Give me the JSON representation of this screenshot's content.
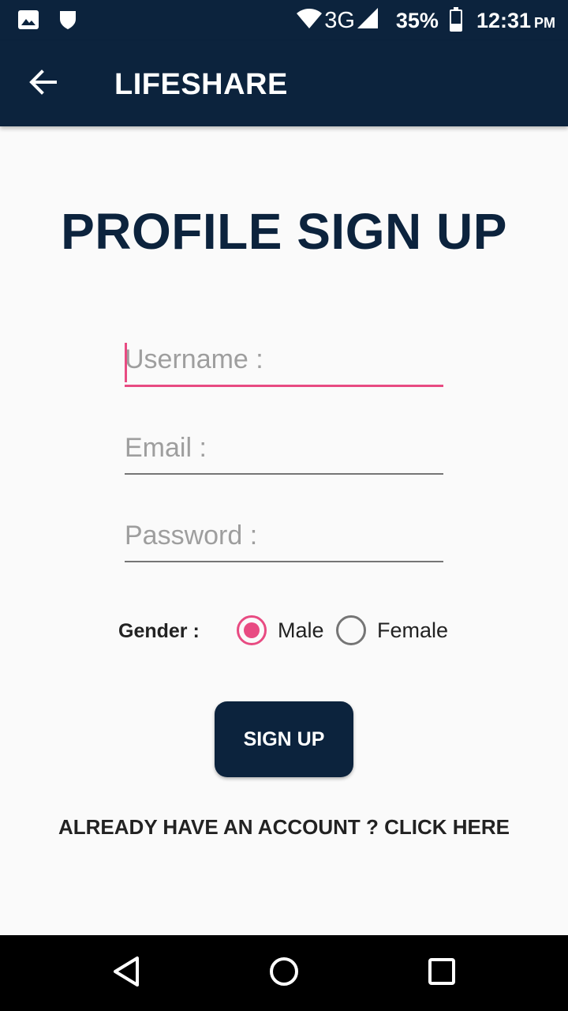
{
  "status_bar": {
    "network": "3G",
    "battery": "35%",
    "battery_level": 0.35,
    "time": "12:31",
    "ampm": "PM",
    "icons": [
      "image-icon",
      "shield-icon",
      "wifi-icon",
      "signal-icon",
      "battery-icon"
    ]
  },
  "app_bar": {
    "title": "LIFESHARE",
    "back_icon": "arrow-left-icon"
  },
  "page": {
    "title": "PROFILE SIGN UP"
  },
  "form": {
    "username": {
      "placeholder": "Username :",
      "value": ""
    },
    "email": {
      "placeholder": "Email :",
      "value": ""
    },
    "password": {
      "placeholder": "Password :",
      "value": ""
    },
    "gender": {
      "label": "Gender :",
      "options": [
        "Male",
        "Female"
      ],
      "selected": "Male"
    },
    "submit_label": "SIGN UP",
    "login_link": "ALREADY HAVE AN ACCOUNT ? CLICK HERE"
  },
  "nav_bar": {
    "icons": [
      "back-triangle-icon",
      "home-circle-icon",
      "recents-square-icon"
    ]
  },
  "colors": {
    "primary": "#0c233d",
    "accent": "#e84b82",
    "background": "#fafafa"
  }
}
